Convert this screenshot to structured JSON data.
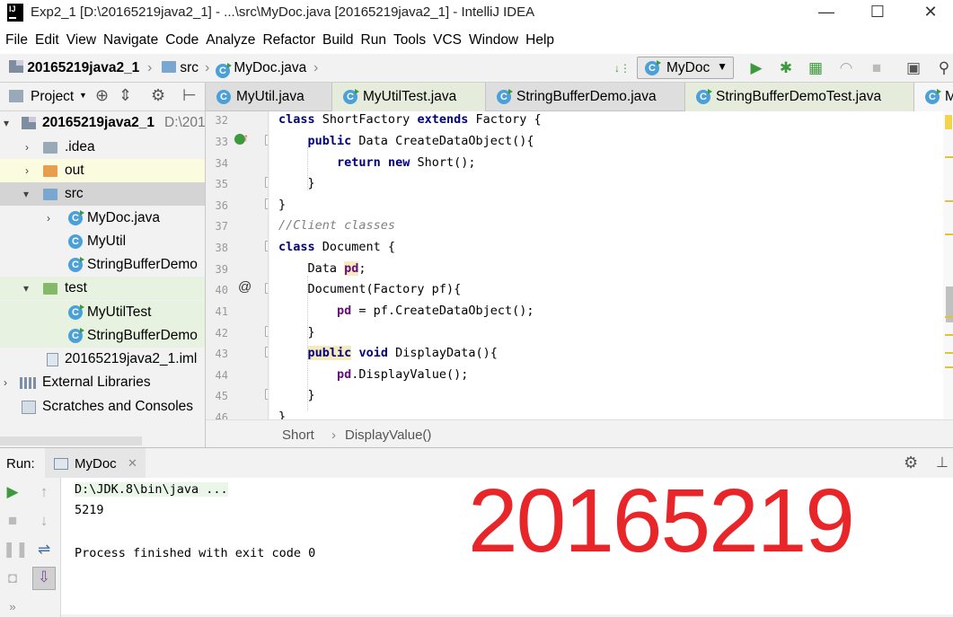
{
  "window": {
    "title": "Exp2_1 [D:\\20165219java2_1] - ...\\src\\MyDoc.java [20165219java2_1] - IntelliJ IDEA",
    "minimize": "—",
    "maximize": "☐",
    "close": "✕"
  },
  "menu": [
    "File",
    "Edit",
    "View",
    "Navigate",
    "Code",
    "Analyze",
    "Refactor",
    "Build",
    "Run",
    "Tools",
    "VCS",
    "Window",
    "Help"
  ],
  "nav": {
    "project": "20165219java2_1",
    "folder": "src",
    "file": "MyDoc.java",
    "run_config": "MyDoc"
  },
  "project_panel": {
    "title": "Project",
    "tree": [
      {
        "label": "20165219java2_1",
        "suffix": "D:\\201"
      },
      {
        "label": ".idea"
      },
      {
        "label": "out"
      },
      {
        "label": "src"
      },
      {
        "label": "MyDoc.java"
      },
      {
        "label": "MyUtil"
      },
      {
        "label": "StringBufferDemo"
      },
      {
        "label": "test"
      },
      {
        "label": "MyUtilTest"
      },
      {
        "label": "StringBufferDemo"
      },
      {
        "label": "20165219java2_1.iml"
      },
      {
        "label": "External Libraries"
      },
      {
        "label": "Scratches and Consoles"
      }
    ]
  },
  "tabs": [
    "MyUtil.java",
    "MyUtilTest.java",
    "StringBufferDemo.java",
    "StringBufferDemoTest.java",
    "M"
  ],
  "editor": {
    "line_numbers": [
      "32",
      "33",
      "34",
      "35",
      "36",
      "37",
      "38",
      "39",
      "40",
      "41",
      "42",
      "43",
      "44",
      "45",
      "46"
    ],
    "lines": [
      {
        "pre": "",
        "kw1": "class",
        "t1": " ShortFactory ",
        "kw2": "extends",
        "t2": " Factory {"
      },
      {
        "pre": "    ",
        "kw1": "public",
        "t1": " Data CreateDataObject(){",
        "kw2": "",
        "t2": ""
      },
      {
        "pre": "        ",
        "kw1": "return",
        "t1": " ",
        "kw2": "new",
        "t2": " Short();"
      },
      {
        "pre": "    ",
        "kw1": "",
        "t1": "}",
        "kw2": "",
        "t2": ""
      },
      {
        "pre": "",
        "kw1": "",
        "t1": "}",
        "kw2": "",
        "t2": ""
      },
      {
        "comment": "//Client classes"
      },
      {
        "pre": "",
        "kw1": "class",
        "t1": " Document {",
        "kw2": "",
        "t2": ""
      },
      {
        "pre": "    ",
        "kw1": "",
        "t1": "Data ",
        "fld": "pd",
        "t2": ";"
      },
      {
        "pre": "    ",
        "kw1": "",
        "t1": "Document(Factory pf){",
        "kw2": "",
        "t2": ""
      },
      {
        "pre": "        ",
        "kw1": "",
        "t1": "",
        "fld": "pd",
        "t2": " = pf.CreateDataObject();"
      },
      {
        "pre": "    ",
        "kw1": "",
        "t1": "}",
        "kw2": "",
        "t2": ""
      },
      {
        "pre": "    ",
        "kw1": "public",
        "t1": " ",
        "kw2": "void",
        "t2": " DisplayData(){"
      },
      {
        "pre": "        ",
        "kw1": "",
        "t1": "",
        "fld": "pd",
        "t2": ".DisplayValue();"
      },
      {
        "pre": "    ",
        "kw1": "",
        "t1": "}",
        "kw2": "",
        "t2": ""
      },
      {
        "pre": "",
        "kw1": "",
        "t1": "}",
        "kw2": "",
        "t2": ""
      }
    ],
    "breadcrumb": [
      "Short",
      "DisplayValue()"
    ],
    "gutter_annotation": "@"
  },
  "run": {
    "label": "Run:",
    "tab": "MyDoc",
    "console": [
      "D:\\JDK.8\\bin\\java ...",
      "5219",
      "",
      "Process finished with exit code 0"
    ]
  },
  "watermark": "20165219",
  "colors": {
    "keyword": "#000080",
    "field": "#660e7a",
    "watermark": "#e8262a",
    "run_green": "#3c9a3c"
  }
}
